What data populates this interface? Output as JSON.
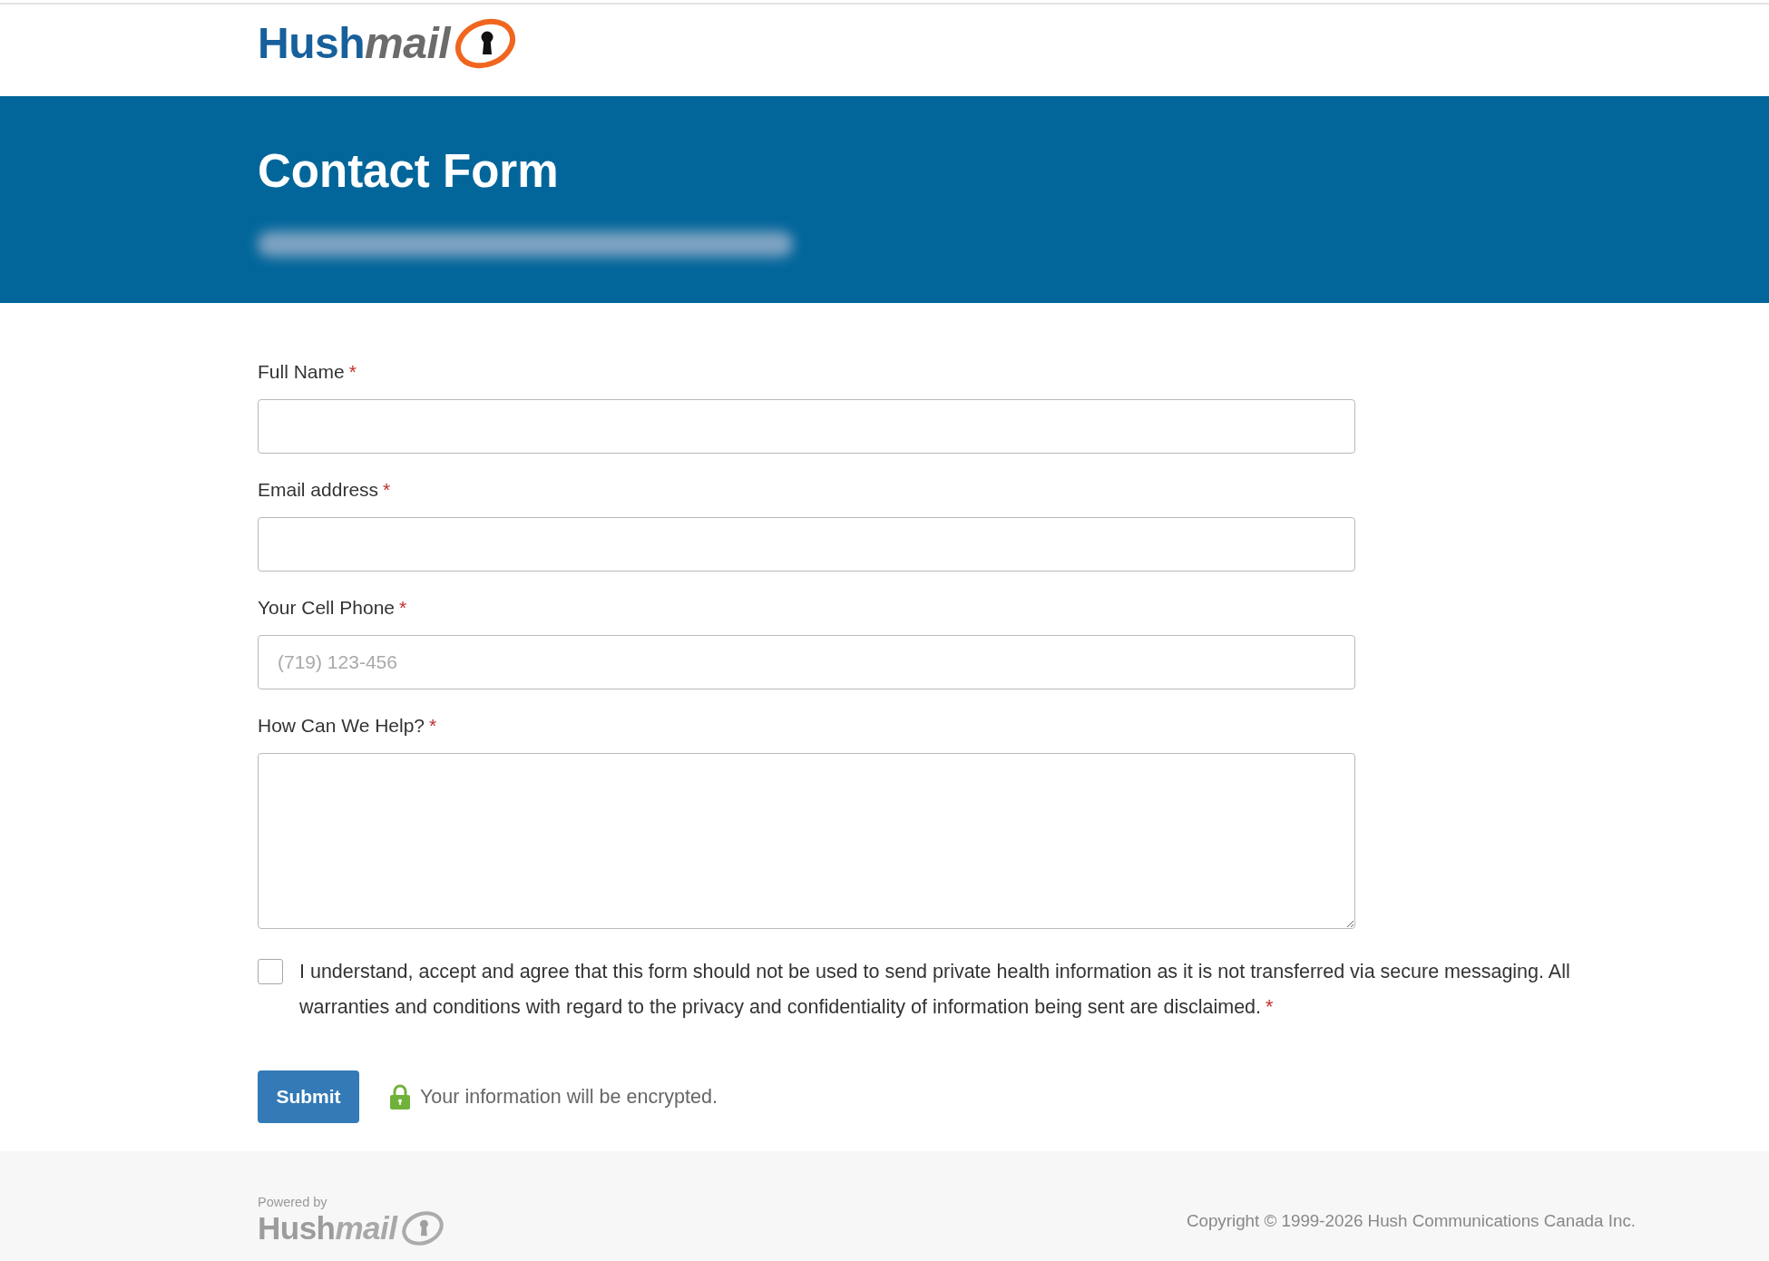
{
  "logo": {
    "brand": "Hush",
    "brand_suffix": "mail"
  },
  "header": {
    "title": "Contact Form",
    "subtitle_blurred": true
  },
  "form": {
    "fields": [
      {
        "kind": "text",
        "label": "Full Name",
        "required_mark": "*"
      },
      {
        "kind": "text",
        "label": "Email address",
        "required_mark": "*"
      },
      {
        "kind": "text",
        "label": "Your Cell Phone",
        "required_mark": "*",
        "placeholder": "(719) 123-456"
      },
      {
        "kind": "textarea",
        "label": "How Can We Help?",
        "required_mark": "*"
      }
    ],
    "consent": {
      "checked": false,
      "text": "I understand, accept and agree that this form should not be used to send private health information as it is not transferred via secure messaging. All warranties and conditions with regard to the privacy and confidentiality of information being sent are disclaimed.",
      "required_mark": "*"
    },
    "submit_button": "Submit",
    "encryption_note": "Your information will be encrypted."
  },
  "footer": {
    "powered_by": "Powered by",
    "logo": {
      "brand": "Hush",
      "brand_suffix": "mail"
    },
    "copyright": "Copyright © 1999-2026 Hush Communications Canada Inc."
  }
}
